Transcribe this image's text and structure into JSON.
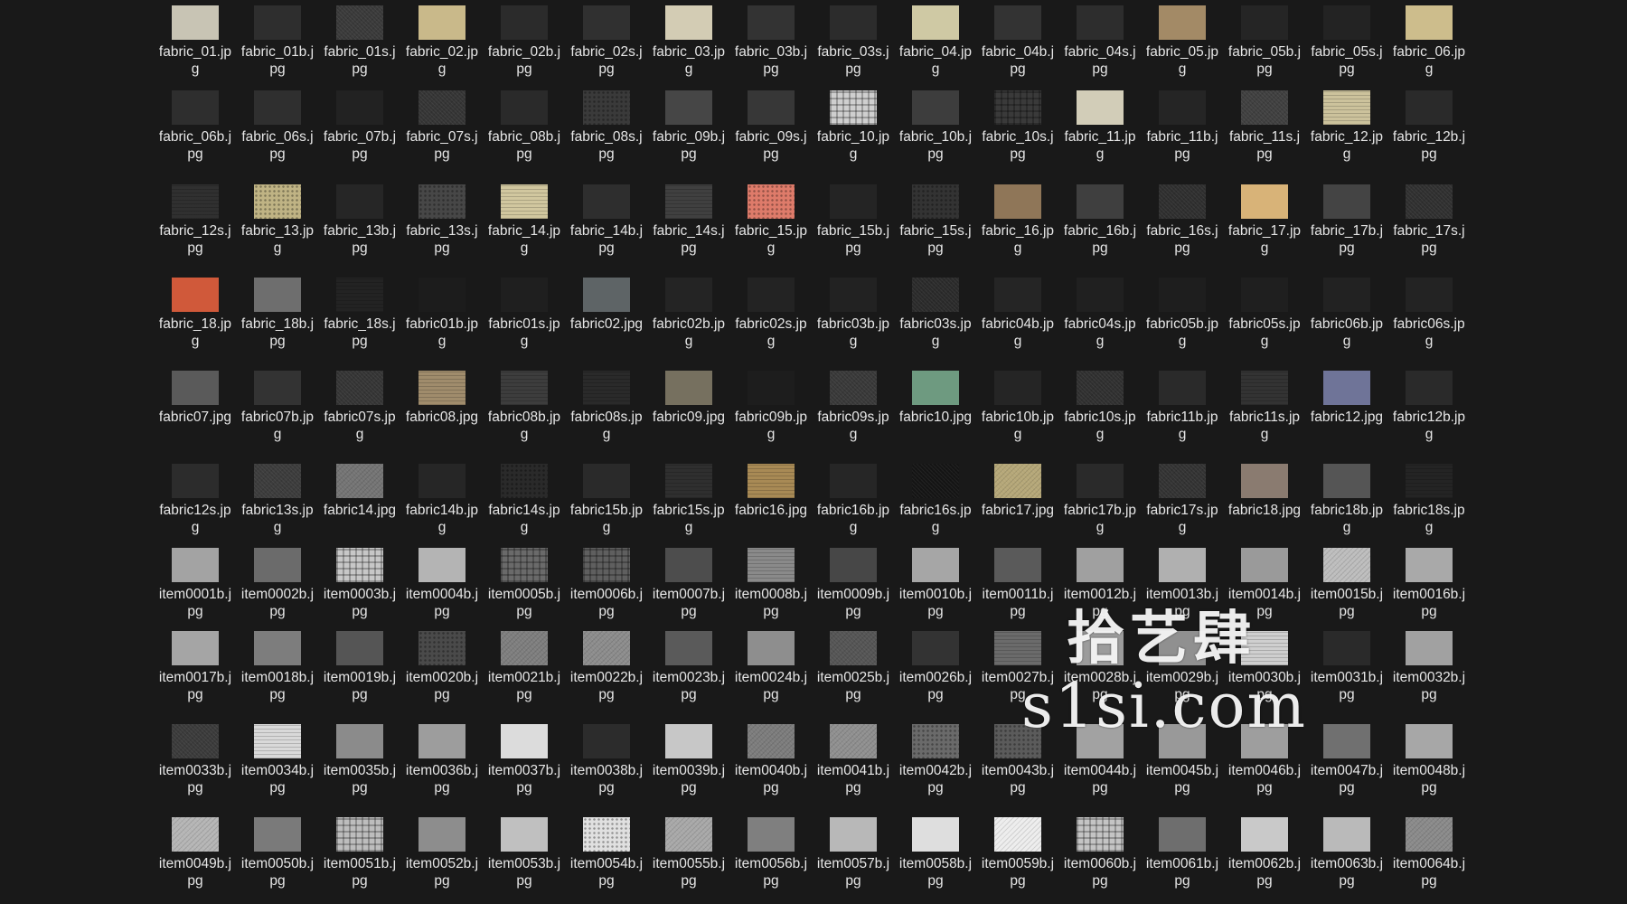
{
  "files": [
    {
      "name": "fabric_01.jpg",
      "thumb": "#c8c4b4"
    },
    {
      "name": "fabric_01b.jpg",
      "thumb": "#2e2e2e"
    },
    {
      "name": "fabric_01s.jpg",
      "thumb": "#3a3a3a",
      "pattern": "noise"
    },
    {
      "name": "fabric_02.jpg",
      "thumb": "#c9b98a"
    },
    {
      "name": "fabric_02b.jpg",
      "thumb": "#2b2b2b"
    },
    {
      "name": "fabric_02s.jpg",
      "thumb": "#303030"
    },
    {
      "name": "fabric_03.jpg",
      "thumb": "#d3ccb4"
    },
    {
      "name": "fabric_03b.jpg",
      "thumb": "#333333"
    },
    {
      "name": "fabric_03s.jpg",
      "thumb": "#2c2c2c"
    },
    {
      "name": "fabric_04.jpg",
      "thumb": "#cfc9a4"
    },
    {
      "name": "fabric_04b.jpg",
      "thumb": "#333333"
    },
    {
      "name": "fabric_04s.jpg",
      "thumb": "#2d2d2d"
    },
    {
      "name": "fabric_05.jpg",
      "thumb": "#a38a66"
    },
    {
      "name": "fabric_05b.jpg",
      "thumb": "#252525"
    },
    {
      "name": "fabric_05s.jpg",
      "thumb": "#232323"
    },
    {
      "name": "fabric_06.jpg",
      "thumb": "#cdbd8c"
    },
    {
      "name": "fabric_06b.jpg",
      "thumb": "#2e2e2e"
    },
    {
      "name": "fabric_06s.jpg",
      "thumb": "#2f2f2f"
    },
    {
      "name": "fabric_07b.jpg",
      "thumb": "#222222"
    },
    {
      "name": "fabric_07s.jpg",
      "thumb": "#353535",
      "pattern": "noise"
    },
    {
      "name": "fabric_08b.jpg",
      "thumb": "#2a2a2a"
    },
    {
      "name": "fabric_08s.jpg",
      "thumb": "#3a3a3a",
      "pattern": "dots"
    },
    {
      "name": "fabric_09b.jpg",
      "thumb": "#464646"
    },
    {
      "name": "fabric_09s.jpg",
      "thumb": "#373737"
    },
    {
      "name": "fabric_10.jpg",
      "thumb": "#cfcfcf",
      "pattern": "plaid"
    },
    {
      "name": "fabric_10b.jpg",
      "thumb": "#3d3d3d"
    },
    {
      "name": "fabric_10s.jpg",
      "thumb": "#3a3a3a",
      "pattern": "plaid"
    },
    {
      "name": "fabric_11.jpg",
      "thumb": "#d2cdb8"
    },
    {
      "name": "fabric_11b.jpg",
      "thumb": "#252525"
    },
    {
      "name": "fabric_11s.jpg",
      "thumb": "#404040",
      "pattern": "noise"
    },
    {
      "name": "fabric_12.jpg",
      "thumb": "#ccc29c",
      "pattern": "stripes"
    },
    {
      "name": "fabric_12b.jpg",
      "thumb": "#2a2a2a"
    },
    {
      "name": "fabric_12s.jpg",
      "thumb": "#303030",
      "pattern": "stripes"
    },
    {
      "name": "fabric_13.jpg",
      "thumb": "#bfb384",
      "pattern": "dots"
    },
    {
      "name": "fabric_13b.jpg",
      "thumb": "#262626"
    },
    {
      "name": "fabric_13s.jpg",
      "thumb": "#474747",
      "pattern": "dots"
    },
    {
      "name": "fabric_14.jpg",
      "thumb": "#d1c79f",
      "pattern": "stripes"
    },
    {
      "name": "fabric_14b.jpg",
      "thumb": "#2e2e2e"
    },
    {
      "name": "fabric_14s.jpg",
      "thumb": "#404040",
      "pattern": "stripes"
    },
    {
      "name": "fabric_15.jpg",
      "thumb": "#de7b6a",
      "pattern": "dots"
    },
    {
      "name": "fabric_15b.jpg",
      "thumb": "#242424"
    },
    {
      "name": "fabric_15s.jpg",
      "thumb": "#333333",
      "pattern": "dots"
    },
    {
      "name": "fabric_16.jpg",
      "thumb": "#8f7658"
    },
    {
      "name": "fabric_16b.jpg",
      "thumb": "#3f3f3f"
    },
    {
      "name": "fabric_16s.jpg",
      "thumb": "#2f2f2f",
      "pattern": "noise"
    },
    {
      "name": "fabric_17.jpg",
      "thumb": "#d8b378"
    },
    {
      "name": "fabric_17b.jpg",
      "thumb": "#444444"
    },
    {
      "name": "fabric_17s.jpg",
      "thumb": "#303030",
      "pattern": "noise"
    },
    {
      "name": "fabric_18.jpg",
      "thumb": "#d0593a"
    },
    {
      "name": "fabric_18b.jpg",
      "thumb": "#6e6e6e"
    },
    {
      "name": "fabric_18s.jpg",
      "thumb": "#232323",
      "pattern": "stripes"
    },
    {
      "name": "fabric01b.jpg",
      "thumb": "#1c1c1c"
    },
    {
      "name": "fabric01s.jpg",
      "thumb": "#1f1f1f"
    },
    {
      "name": "fabric02.jpg",
      "thumb": "#5e6466"
    },
    {
      "name": "fabric02b.jpg",
      "thumb": "#242424"
    },
    {
      "name": "fabric02s.jpg",
      "thumb": "#232323"
    },
    {
      "name": "fabric03b.jpg",
      "thumb": "#222222"
    },
    {
      "name": "fabric03s.jpg",
      "thumb": "#2b2b2b",
      "pattern": "noise"
    },
    {
      "name": "fabric04b.jpg",
      "thumb": "#252525"
    },
    {
      "name": "fabric04s.jpg",
      "thumb": "#202020"
    },
    {
      "name": "fabric05b.jpg",
      "thumb": "#1e1e1e"
    },
    {
      "name": "fabric05s.jpg",
      "thumb": "#1f1f1f"
    },
    {
      "name": "fabric06b.jpg",
      "thumb": "#222222"
    },
    {
      "name": "fabric06s.jpg",
      "thumb": "#232323"
    },
    {
      "name": "fabric07.jpg",
      "thumb": "#5a5a5a"
    },
    {
      "name": "fabric07b.jpg",
      "thumb": "#333333"
    },
    {
      "name": "fabric07s.jpg",
      "thumb": "#353535",
      "pattern": "noise"
    },
    {
      "name": "fabric08.jpg",
      "thumb": "#a08c6c",
      "pattern": "stripes"
    },
    {
      "name": "fabric08b.jpg",
      "thumb": "#3d3d3d",
      "pattern": "stripes"
    },
    {
      "name": "fabric08s.jpg",
      "thumb": "#2a2a2a",
      "pattern": "stripes"
    },
    {
      "name": "fabric09.jpg",
      "thumb": "#76705f"
    },
    {
      "name": "fabric09b.jpg",
      "thumb": "#1d1d1d"
    },
    {
      "name": "fabric09s.jpg",
      "thumb": "#393939",
      "pattern": "noise"
    },
    {
      "name": "fabric10.jpg",
      "thumb": "#6e9a80"
    },
    {
      "name": "fabric10b.jpg",
      "thumb": "#252525"
    },
    {
      "name": "fabric10s.jpg",
      "thumb": "#303030",
      "pattern": "noise"
    },
    {
      "name": "fabric11b.jpg",
      "thumb": "#2a2a2a"
    },
    {
      "name": "fabric11s.jpg",
      "thumb": "#333333",
      "pattern": "stripes"
    },
    {
      "name": "fabric12.jpg",
      "thumb": "#6f7498"
    },
    {
      "name": "fabric12b.jpg",
      "thumb": "#2a2a2a"
    },
    {
      "name": "fabric12s.jpg",
      "thumb": "#2c2c2c"
    },
    {
      "name": "fabric13s.jpg",
      "thumb": "#3c3c3c",
      "pattern": "noise"
    },
    {
      "name": "fabric14.jpg",
      "thumb": "#747474",
      "pattern": "noise"
    },
    {
      "name": "fabric14b.jpg",
      "thumb": "#262626"
    },
    {
      "name": "fabric14s.jpg",
      "thumb": "#2a2a2a",
      "pattern": "dots"
    },
    {
      "name": "fabric15b.jpg",
      "thumb": "#2a2a2a"
    },
    {
      "name": "fabric15s.jpg",
      "thumb": "#2f2f2f",
      "pattern": "stripes"
    },
    {
      "name": "fabric16.jpg",
      "thumb": "#a88a55",
      "pattern": "stripes"
    },
    {
      "name": "fabric16b.jpg",
      "thumb": "#262626"
    },
    {
      "name": "fabric16s.jpg",
      "thumb": "#151515",
      "pattern": "noise"
    },
    {
      "name": "fabric17.jpg",
      "thumb": "#b5a778",
      "pattern": "noise"
    },
    {
      "name": "fabric17b.jpg",
      "thumb": "#2a2a2a"
    },
    {
      "name": "fabric17s.jpg",
      "thumb": "#333333",
      "pattern": "noise"
    },
    {
      "name": "fabric18.jpg",
      "thumb": "#8a7b70"
    },
    {
      "name": "fabric18b.jpg",
      "thumb": "#555555"
    },
    {
      "name": "fabric18s.jpg",
      "thumb": "#242424",
      "pattern": "stripes"
    },
    {
      "name": "item0001b.jpg",
      "thumb": "#a3a3a3"
    },
    {
      "name": "item0002b.jpg",
      "thumb": "#6b6b6b"
    },
    {
      "name": "item0003b.jpg",
      "thumb": "#c7c7c7",
      "pattern": "plaid"
    },
    {
      "name": "item0004b.jpg",
      "thumb": "#b4b4b4"
    },
    {
      "name": "item0005b.jpg",
      "thumb": "#6a6a6a",
      "pattern": "plaid"
    },
    {
      "name": "item0006b.jpg",
      "thumb": "#5f5f5f",
      "pattern": "plaid"
    },
    {
      "name": "item0007b.jpg",
      "thumb": "#4d4d4d"
    },
    {
      "name": "item0008b.jpg",
      "thumb": "#8a8a8a",
      "pattern": "stripes"
    },
    {
      "name": "item0009b.jpg",
      "thumb": "#474747"
    },
    {
      "name": "item0010b.jpg",
      "thumb": "#a6a6a6"
    },
    {
      "name": "item0011b.jpg",
      "thumb": "#5a5a5a"
    },
    {
      "name": "item0012b.jpg",
      "thumb": "#a0a0a0"
    },
    {
      "name": "item0013b.jpg",
      "thumb": "#b0b0b0"
    },
    {
      "name": "item0014b.jpg",
      "thumb": "#9a9a9a"
    },
    {
      "name": "item0015b.jpg",
      "thumb": "#bdbdbd",
      "pattern": "noise"
    },
    {
      "name": "item0016b.jpg",
      "thumb": "#a9a9a9"
    },
    {
      "name": "item0017b.jpg",
      "thumb": "#a5a5a5"
    },
    {
      "name": "item0018b.jpg",
      "thumb": "#7d7d7d"
    },
    {
      "name": "item0019b.jpg",
      "thumb": "#555555"
    },
    {
      "name": "item0020b.jpg",
      "thumb": "#4a4a4a",
      "pattern": "dots"
    },
    {
      "name": "item0021b.jpg",
      "thumb": "#7e7e7e",
      "pattern": "noise"
    },
    {
      "name": "item0022b.jpg",
      "thumb": "#8c8c8c",
      "pattern": "noise"
    },
    {
      "name": "item0023b.jpg",
      "thumb": "#5a5a5a"
    },
    {
      "name": "item0024b.jpg",
      "thumb": "#8e8e8e"
    },
    {
      "name": "item0025b.jpg",
      "thumb": "#555555",
      "pattern": "noise"
    },
    {
      "name": "item0026b.jpg",
      "thumb": "#333333"
    },
    {
      "name": "item0027b.jpg",
      "thumb": "#6b6b6b",
      "pattern": "stripes"
    },
    {
      "name": "item0028b.jpg",
      "thumb": "#9c9c9c"
    },
    {
      "name": "item0029b.jpg",
      "thumb": "#909090"
    },
    {
      "name": "item0030b.jpg",
      "thumb": "#cfcfcf",
      "pattern": "stripes"
    },
    {
      "name": "item0031b.jpg",
      "thumb": "#2a2a2a"
    },
    {
      "name": "item0032b.jpg",
      "thumb": "#a1a1a1"
    },
    {
      "name": "item0033b.jpg",
      "thumb": "#3b3b3b",
      "pattern": "noise"
    },
    {
      "name": "item0034b.jpg",
      "thumb": "#d9d9d9",
      "pattern": "stripes"
    },
    {
      "name": "item0035b.jpg",
      "thumb": "#8b8b8b"
    },
    {
      "name": "item0036b.jpg",
      "thumb": "#9d9d9d"
    },
    {
      "name": "item0037b.jpg",
      "thumb": "#dcdcdc"
    },
    {
      "name": "item0038b.jpg",
      "thumb": "#2c2c2c"
    },
    {
      "name": "item0039b.jpg",
      "thumb": "#c7c7c7"
    },
    {
      "name": "item0040b.jpg",
      "thumb": "#7c7c7c",
      "pattern": "noise"
    },
    {
      "name": "item0041b.jpg",
      "thumb": "#8f8f8f",
      "pattern": "noise"
    },
    {
      "name": "item0042b.jpg",
      "thumb": "#6a6a6a",
      "pattern": "dots"
    },
    {
      "name": "item0043b.jpg",
      "thumb": "#5b5b5b",
      "pattern": "dots"
    },
    {
      "name": "item0044b.jpg",
      "thumb": "#a2a2a2"
    },
    {
      "name": "item0045b.jpg",
      "thumb": "#999999"
    },
    {
      "name": "item0046b.jpg",
      "thumb": "#9e9e9e"
    },
    {
      "name": "item0047b.jpg",
      "thumb": "#707070"
    },
    {
      "name": "item0048b.jpg",
      "thumb": "#a7a7a7"
    },
    {
      "name": "item0049b.jpg",
      "thumb": "#b5b5b5",
      "pattern": "noise"
    },
    {
      "name": "item0050b.jpg",
      "thumb": "#7a7a7a"
    },
    {
      "name": "item0051b.jpg",
      "thumb": "#bdbdbd",
      "pattern": "plaid"
    },
    {
      "name": "item0052b.jpg",
      "thumb": "#8d8d8d"
    },
    {
      "name": "item0053b.jpg",
      "thumb": "#c0c0c0"
    },
    {
      "name": "item0054b.jpg",
      "thumb": "#e0e0e0",
      "pattern": "dots"
    },
    {
      "name": "item0055b.jpg",
      "thumb": "#a8a8a8",
      "pattern": "noise"
    },
    {
      "name": "item0056b.jpg",
      "thumb": "#7f7f7f"
    },
    {
      "name": "item0057b.jpg",
      "thumb": "#b8b8b8"
    },
    {
      "name": "item0058b.jpg",
      "thumb": "#dedede"
    },
    {
      "name": "item0059b.jpg",
      "thumb": "#ededed",
      "pattern": "noise"
    },
    {
      "name": "item0060b.jpg",
      "thumb": "#c4c4c4",
      "pattern": "plaid"
    },
    {
      "name": "item0061b.jpg",
      "thumb": "#6e6e6e"
    },
    {
      "name": "item0062b.jpg",
      "thumb": "#c9c9c9"
    },
    {
      "name": "item0063b.jpg",
      "thumb": "#bababa"
    },
    {
      "name": "item0064b.jpg",
      "thumb": "#8a8a8a",
      "pattern": "noise"
    }
  ],
  "watermark": {
    "chinese_text": "拾艺肆",
    "url_text": "s1si.com"
  }
}
